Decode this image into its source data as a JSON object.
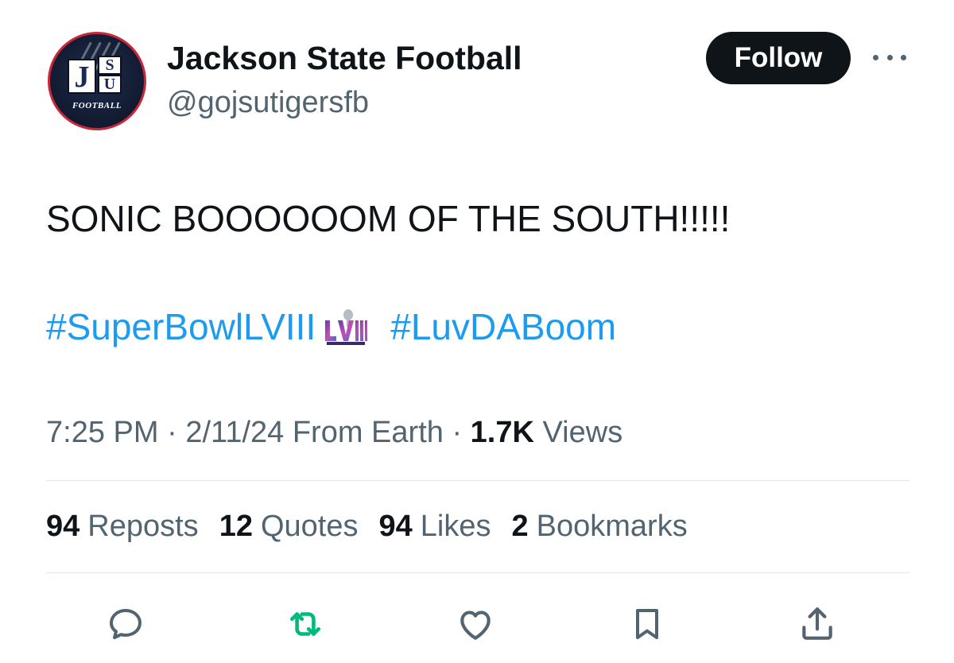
{
  "author": {
    "display_name": "Jackson State Football",
    "handle": "@gojsutigersfb",
    "avatar": {
      "letters": [
        "J",
        "S",
        "U"
      ],
      "caption": "FOOTBALL"
    }
  },
  "follow_label": "Follow",
  "more_icon": "more-horizontal-icon",
  "tweet": {
    "text": "SONIC BOOOOOOM OF THE SOUTH!!!!!",
    "hashtag_1": "#SuperBowlLVIII",
    "hashtag_2": "#LuvDABoom",
    "emoji": "super-bowl-lviii-icon"
  },
  "meta": {
    "time": "7:25 PM",
    "date": "2/11/24",
    "source": "From Earth",
    "views_count": "1.7K",
    "views_label": "Views",
    "separator": "·"
  },
  "stats": [
    {
      "count": "94",
      "label": "Reposts"
    },
    {
      "count": "12",
      "label": "Quotes"
    },
    {
      "count": "94",
      "label": "Likes"
    },
    {
      "count": "2",
      "label": "Bookmarks"
    }
  ],
  "actions": [
    "reply-icon",
    "repost-icon",
    "like-icon",
    "bookmark-icon",
    "share-icon"
  ],
  "colors": {
    "link": "#1d9bf0",
    "secondary": "#536471",
    "primary_text": "#0f1419",
    "repost_green": "#00ba7c",
    "avatar_border": "#c8283a"
  }
}
